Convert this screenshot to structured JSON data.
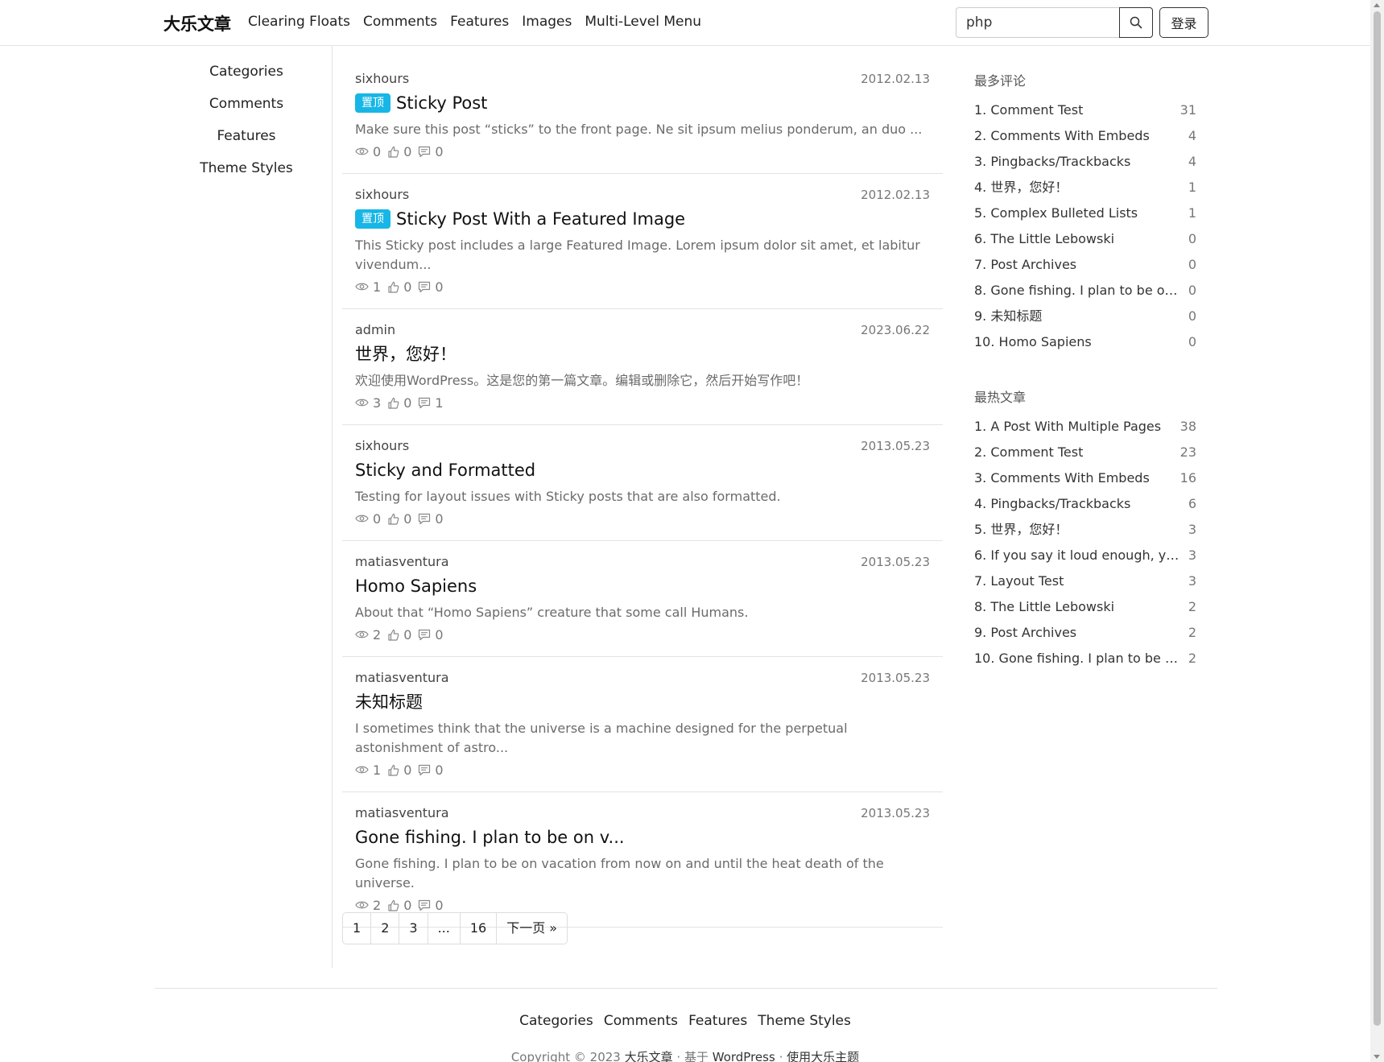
{
  "brand": "大乐文章",
  "nav": [
    "Clearing Floats",
    "Comments",
    "Features",
    "Images",
    "Multi-Level Menu"
  ],
  "search": {
    "value": "php",
    "icon": "search-icon"
  },
  "login_label": "登录",
  "left_nav": [
    "Categories",
    "Comments",
    "Features",
    "Theme Styles"
  ],
  "posts": [
    {
      "author": "sixhours",
      "date": "2012.02.13",
      "badge": "置顶",
      "title": "Sticky Post",
      "excerpt": "Make sure this post “sticks” to the front page. Ne sit ipsum melius ponderum, an duo ...",
      "views": "0",
      "likes": "0",
      "comments": "0"
    },
    {
      "author": "sixhours",
      "date": "2012.02.13",
      "badge": "置顶",
      "title": "Sticky Post With a Featured Image",
      "excerpt": "This Sticky post includes a large Featured Image. Lorem ipsum dolor sit amet, et labitur vivendum...",
      "views": "1",
      "likes": "0",
      "comments": "0"
    },
    {
      "author": "admin",
      "date": "2023.06.22",
      "badge": "",
      "title": "世界，您好！",
      "excerpt": "欢迎使用WordPress。这是您的第一篇文章。编辑或删除它，然后开始写作吧！",
      "views": "3",
      "likes": "0",
      "comments": "1"
    },
    {
      "author": "sixhours",
      "date": "2013.05.23",
      "badge": "",
      "title": "Sticky and Formatted",
      "excerpt": "Testing for layout issues with Sticky posts that are also formatted.",
      "views": "0",
      "likes": "0",
      "comments": "0"
    },
    {
      "author": "matiasventura",
      "date": "2013.05.23",
      "badge": "",
      "title": "Homo Sapiens",
      "excerpt": "About that “Homo Sapiens” creature that some call Humans.",
      "views": "2",
      "likes": "0",
      "comments": "0"
    },
    {
      "author": "matiasventura",
      "date": "2013.05.23",
      "badge": "",
      "title": "未知标题",
      "excerpt": "I sometimes think that the universe is a machine designed for the perpetual astonishment of astro...",
      "views": "1",
      "likes": "0",
      "comments": "0"
    },
    {
      "author": "matiasventura",
      "date": "2013.05.23",
      "badge": "",
      "title": "Gone fishing. I plan to be on v...",
      "excerpt": "Gone fishing. I plan to be on vacation from now on and until the heat death of the universe.",
      "views": "2",
      "likes": "0",
      "comments": "0"
    }
  ],
  "pagination": [
    "1",
    "2",
    "3",
    "...",
    "16",
    "下一页 »"
  ],
  "most_comments": {
    "title": "最多评论",
    "items": [
      {
        "rank": "1.",
        "title": "Comment Test",
        "count": "31"
      },
      {
        "rank": "2.",
        "title": "Comments With Embeds",
        "count": "4"
      },
      {
        "rank": "3.",
        "title": "Pingbacks/Trackbacks",
        "count": "4"
      },
      {
        "rank": "4.",
        "title": "世界，您好！",
        "count": "1"
      },
      {
        "rank": "5.",
        "title": "Complex Bulleted Lists",
        "count": "1"
      },
      {
        "rank": "6.",
        "title": "The Little Lebowski",
        "count": "0"
      },
      {
        "rank": "7.",
        "title": "Post Archives",
        "count": "0"
      },
      {
        "rank": "8.",
        "title": "Gone fishing. I plan to be on v...",
        "count": "0"
      },
      {
        "rank": "9.",
        "title": "未知标题",
        "count": "0"
      },
      {
        "rank": "10.",
        "title": "Homo Sapiens",
        "count": "0"
      }
    ]
  },
  "hot_posts": {
    "title": "最热文章",
    "items": [
      {
        "rank": "1.",
        "title": "A Post With Multiple Pages",
        "count": "38"
      },
      {
        "rank": "2.",
        "title": "Comment Test",
        "count": "23"
      },
      {
        "rank": "3.",
        "title": "Comments With Embeds",
        "count": "16"
      },
      {
        "rank": "4.",
        "title": "Pingbacks/Trackbacks",
        "count": "6"
      },
      {
        "rank": "5.",
        "title": "世界，您好！",
        "count": "3"
      },
      {
        "rank": "6.",
        "title": "If you say it loud enough, you'l...",
        "count": "3"
      },
      {
        "rank": "7.",
        "title": "Layout Test",
        "count": "3"
      },
      {
        "rank": "8.",
        "title": "The Little Lebowski",
        "count": "2"
      },
      {
        "rank": "9.",
        "title": "Post Archives",
        "count": "2"
      },
      {
        "rank": "10.",
        "title": "Gone fishing. I plan to be on v...",
        "count": "2"
      }
    ]
  },
  "footer": {
    "links": [
      "Categories",
      "Comments",
      "Features",
      "Theme Styles"
    ],
    "copyright_prefix": "Copyright © 2023",
    "site_link": "大乐文章",
    "sep1": "· 基于",
    "wp_link": "WordPress",
    "sep2": "·",
    "theme_link": "使用大乐主题"
  },
  "colors": {
    "badge": "#17b6e6",
    "border": "#e3e3e3"
  }
}
